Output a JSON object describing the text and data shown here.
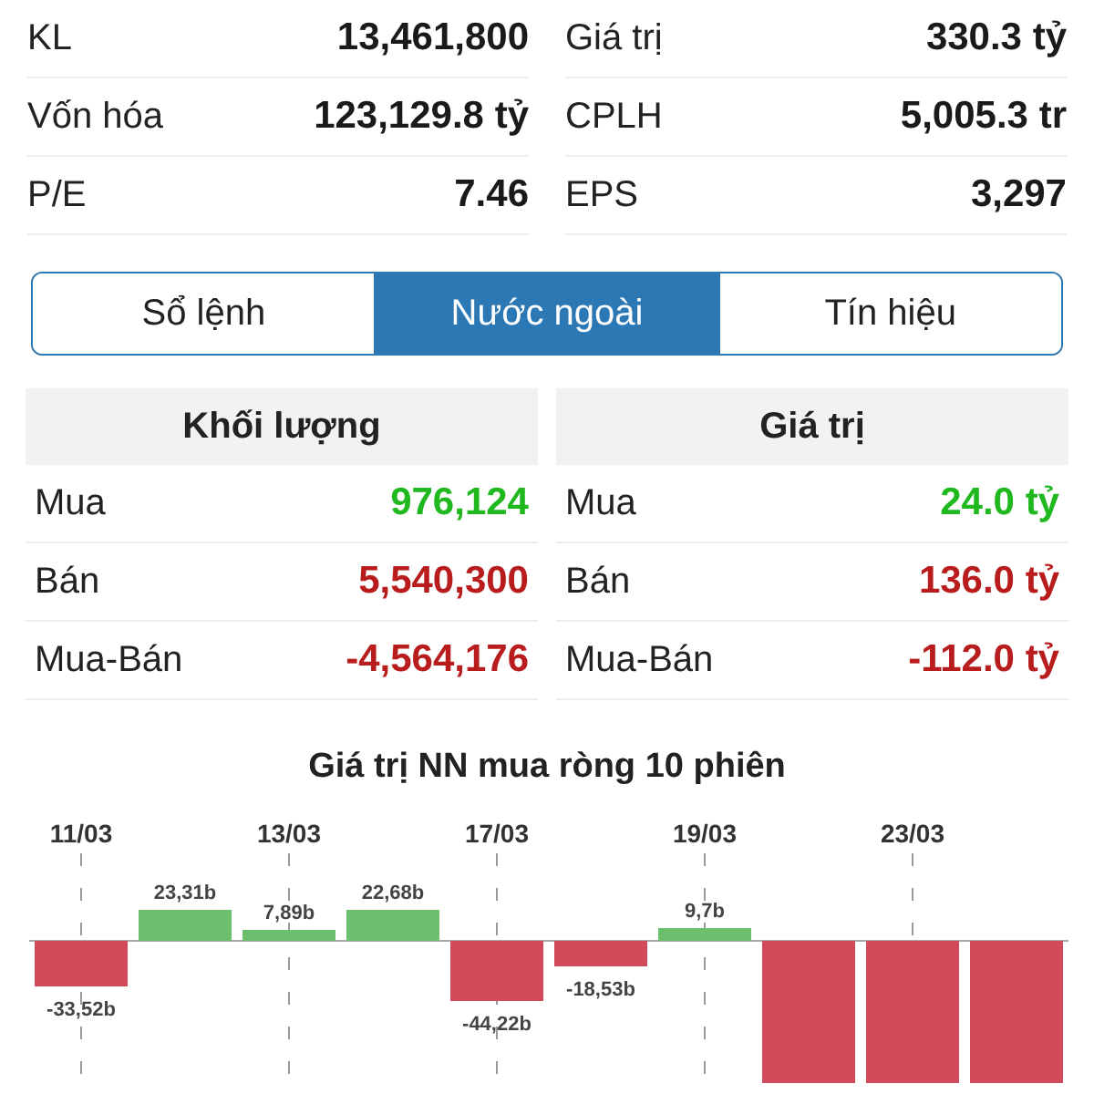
{
  "stats": [
    {
      "left": {
        "label": "KL",
        "value": "13,461,800"
      },
      "right": {
        "label": "Giá trị",
        "value": "330.3 tỷ"
      }
    },
    {
      "left": {
        "label": "Vốn hóa",
        "value": "123,129.8 tỷ"
      },
      "right": {
        "label": "CPLH",
        "value": "5,005.3 tr"
      }
    },
    {
      "left": {
        "label": "P/E",
        "value": "7.46"
      },
      "right": {
        "label": "EPS",
        "value": "3,297"
      }
    }
  ],
  "tabs": [
    {
      "label": "Sổ lệnh",
      "selected": false
    },
    {
      "label": "Nước ngoài",
      "selected": true
    },
    {
      "label": "Tín hiệu",
      "selected": false
    }
  ],
  "foreign": [
    {
      "title": "Khối lượng",
      "rows": [
        {
          "label": "Mua",
          "value": "976,124",
          "color": "#1fb81f"
        },
        {
          "label": "Bán",
          "value": "5,540,300",
          "color": "#b81c1c"
        },
        {
          "label": "Mua-Bán",
          "value": "-4,564,176",
          "color": "#b81c1c"
        }
      ]
    },
    {
      "title": "Giá trị",
      "rows": [
        {
          "label": "Mua",
          "value": "24.0 tỷ",
          "color": "#1fb81f"
        },
        {
          "label": "Bán",
          "value": "136.0 tỷ",
          "color": "#b81c1c"
        },
        {
          "label": "Mua-Bán",
          "value": "-112.0 tỷ",
          "color": "#b81c1c"
        }
      ]
    }
  ],
  "net_chart": {
    "title": "Giá trị NN mua ròng 10 phiên",
    "dates": [
      "11/03",
      "13/03",
      "17/03",
      "19/03",
      "23/03"
    ],
    "bar_labels": [
      "-33,52b",
      "23,31b",
      "7,89b",
      "22,68b",
      "-44,22b",
      "-18,53b",
      "9,7b"
    ]
  }
}
